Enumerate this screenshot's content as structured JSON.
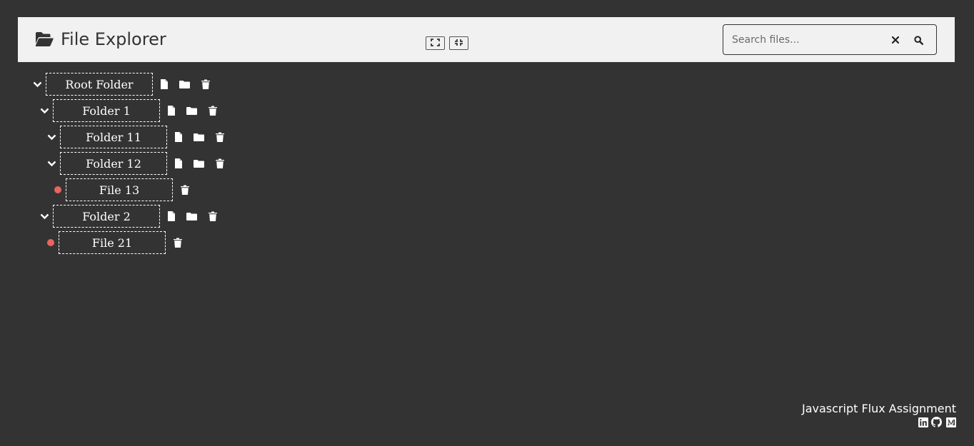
{
  "app": {
    "title": "File Explorer",
    "title_icon": "folder-open-icon"
  },
  "toolbar": {
    "expand_all_icon": "expand-icon",
    "collapse_all_icon": "compress-icon"
  },
  "search": {
    "placeholder": "Search files...",
    "value": "",
    "clear_icon": "close-icon",
    "submit_icon": "search-icon"
  },
  "tree": {
    "root": {
      "name": "Root Folder",
      "type": "folder",
      "expanded": true
    },
    "folder_1": {
      "name": "Folder 1",
      "type": "folder",
      "expanded": true
    },
    "folder_11": {
      "name": "Folder 11",
      "type": "folder",
      "expanded": true
    },
    "folder_12": {
      "name": "Folder 12",
      "type": "folder",
      "expanded": true
    },
    "file_13": {
      "name": "File 13",
      "type": "file"
    },
    "folder_2": {
      "name": "Folder 2",
      "type": "folder",
      "expanded": true
    },
    "file_21": {
      "name": "File 21",
      "type": "file"
    },
    "actions": {
      "add_file_icon": "file-icon",
      "add_folder_icon": "folder-icon",
      "delete_icon": "trash-icon"
    }
  },
  "footer": {
    "text": "Javascript Flux Assignment",
    "links": [
      "linkedin-icon",
      "github-icon",
      "medium-icon"
    ]
  },
  "colors": {
    "background": "#333333",
    "header_background": "#f1f1f1",
    "file_dot": "#e8645f",
    "text": "#ffffff"
  }
}
